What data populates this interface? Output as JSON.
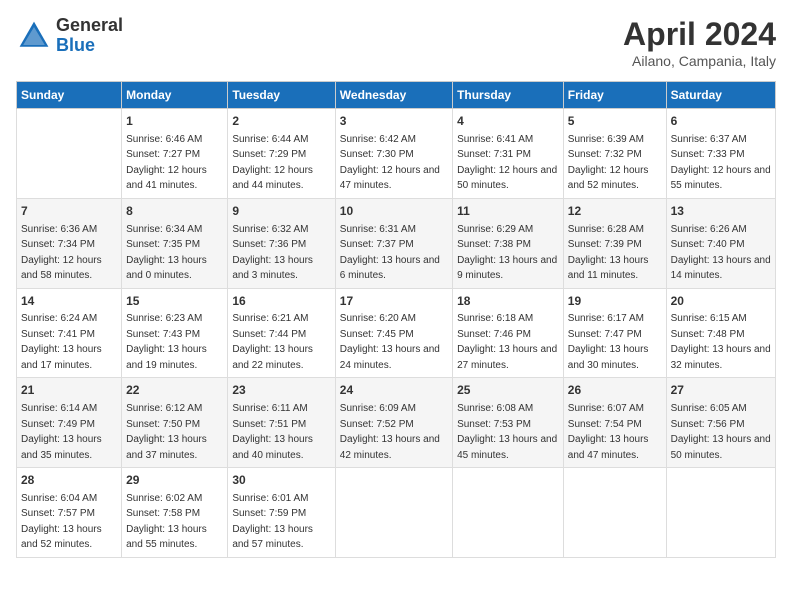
{
  "header": {
    "logo_general": "General",
    "logo_blue": "Blue",
    "title": "April 2024",
    "subtitle": "Ailano, Campania, Italy"
  },
  "weekdays": [
    "Sunday",
    "Monday",
    "Tuesday",
    "Wednesday",
    "Thursday",
    "Friday",
    "Saturday"
  ],
  "weeks": [
    [
      {
        "day": "",
        "sunrise": "",
        "sunset": "",
        "daylight": ""
      },
      {
        "day": "1",
        "sunrise": "Sunrise: 6:46 AM",
        "sunset": "Sunset: 7:27 PM",
        "daylight": "Daylight: 12 hours and 41 minutes."
      },
      {
        "day": "2",
        "sunrise": "Sunrise: 6:44 AM",
        "sunset": "Sunset: 7:29 PM",
        "daylight": "Daylight: 12 hours and 44 minutes."
      },
      {
        "day": "3",
        "sunrise": "Sunrise: 6:42 AM",
        "sunset": "Sunset: 7:30 PM",
        "daylight": "Daylight: 12 hours and 47 minutes."
      },
      {
        "day": "4",
        "sunrise": "Sunrise: 6:41 AM",
        "sunset": "Sunset: 7:31 PM",
        "daylight": "Daylight: 12 hours and 50 minutes."
      },
      {
        "day": "5",
        "sunrise": "Sunrise: 6:39 AM",
        "sunset": "Sunset: 7:32 PM",
        "daylight": "Daylight: 12 hours and 52 minutes."
      },
      {
        "day": "6",
        "sunrise": "Sunrise: 6:37 AM",
        "sunset": "Sunset: 7:33 PM",
        "daylight": "Daylight: 12 hours and 55 minutes."
      }
    ],
    [
      {
        "day": "7",
        "sunrise": "Sunrise: 6:36 AM",
        "sunset": "Sunset: 7:34 PM",
        "daylight": "Daylight: 12 hours and 58 minutes."
      },
      {
        "day": "8",
        "sunrise": "Sunrise: 6:34 AM",
        "sunset": "Sunset: 7:35 PM",
        "daylight": "Daylight: 13 hours and 0 minutes."
      },
      {
        "day": "9",
        "sunrise": "Sunrise: 6:32 AM",
        "sunset": "Sunset: 7:36 PM",
        "daylight": "Daylight: 13 hours and 3 minutes."
      },
      {
        "day": "10",
        "sunrise": "Sunrise: 6:31 AM",
        "sunset": "Sunset: 7:37 PM",
        "daylight": "Daylight: 13 hours and 6 minutes."
      },
      {
        "day": "11",
        "sunrise": "Sunrise: 6:29 AM",
        "sunset": "Sunset: 7:38 PM",
        "daylight": "Daylight: 13 hours and 9 minutes."
      },
      {
        "day": "12",
        "sunrise": "Sunrise: 6:28 AM",
        "sunset": "Sunset: 7:39 PM",
        "daylight": "Daylight: 13 hours and 11 minutes."
      },
      {
        "day": "13",
        "sunrise": "Sunrise: 6:26 AM",
        "sunset": "Sunset: 7:40 PM",
        "daylight": "Daylight: 13 hours and 14 minutes."
      }
    ],
    [
      {
        "day": "14",
        "sunrise": "Sunrise: 6:24 AM",
        "sunset": "Sunset: 7:41 PM",
        "daylight": "Daylight: 13 hours and 17 minutes."
      },
      {
        "day": "15",
        "sunrise": "Sunrise: 6:23 AM",
        "sunset": "Sunset: 7:43 PM",
        "daylight": "Daylight: 13 hours and 19 minutes."
      },
      {
        "day": "16",
        "sunrise": "Sunrise: 6:21 AM",
        "sunset": "Sunset: 7:44 PM",
        "daylight": "Daylight: 13 hours and 22 minutes."
      },
      {
        "day": "17",
        "sunrise": "Sunrise: 6:20 AM",
        "sunset": "Sunset: 7:45 PM",
        "daylight": "Daylight: 13 hours and 24 minutes."
      },
      {
        "day": "18",
        "sunrise": "Sunrise: 6:18 AM",
        "sunset": "Sunset: 7:46 PM",
        "daylight": "Daylight: 13 hours and 27 minutes."
      },
      {
        "day": "19",
        "sunrise": "Sunrise: 6:17 AM",
        "sunset": "Sunset: 7:47 PM",
        "daylight": "Daylight: 13 hours and 30 minutes."
      },
      {
        "day": "20",
        "sunrise": "Sunrise: 6:15 AM",
        "sunset": "Sunset: 7:48 PM",
        "daylight": "Daylight: 13 hours and 32 minutes."
      }
    ],
    [
      {
        "day": "21",
        "sunrise": "Sunrise: 6:14 AM",
        "sunset": "Sunset: 7:49 PM",
        "daylight": "Daylight: 13 hours and 35 minutes."
      },
      {
        "day": "22",
        "sunrise": "Sunrise: 6:12 AM",
        "sunset": "Sunset: 7:50 PM",
        "daylight": "Daylight: 13 hours and 37 minutes."
      },
      {
        "day": "23",
        "sunrise": "Sunrise: 6:11 AM",
        "sunset": "Sunset: 7:51 PM",
        "daylight": "Daylight: 13 hours and 40 minutes."
      },
      {
        "day": "24",
        "sunrise": "Sunrise: 6:09 AM",
        "sunset": "Sunset: 7:52 PM",
        "daylight": "Daylight: 13 hours and 42 minutes."
      },
      {
        "day": "25",
        "sunrise": "Sunrise: 6:08 AM",
        "sunset": "Sunset: 7:53 PM",
        "daylight": "Daylight: 13 hours and 45 minutes."
      },
      {
        "day": "26",
        "sunrise": "Sunrise: 6:07 AM",
        "sunset": "Sunset: 7:54 PM",
        "daylight": "Daylight: 13 hours and 47 minutes."
      },
      {
        "day": "27",
        "sunrise": "Sunrise: 6:05 AM",
        "sunset": "Sunset: 7:56 PM",
        "daylight": "Daylight: 13 hours and 50 minutes."
      }
    ],
    [
      {
        "day": "28",
        "sunrise": "Sunrise: 6:04 AM",
        "sunset": "Sunset: 7:57 PM",
        "daylight": "Daylight: 13 hours and 52 minutes."
      },
      {
        "day": "29",
        "sunrise": "Sunrise: 6:02 AM",
        "sunset": "Sunset: 7:58 PM",
        "daylight": "Daylight: 13 hours and 55 minutes."
      },
      {
        "day": "30",
        "sunrise": "Sunrise: 6:01 AM",
        "sunset": "Sunset: 7:59 PM",
        "daylight": "Daylight: 13 hours and 57 minutes."
      },
      {
        "day": "",
        "sunrise": "",
        "sunset": "",
        "daylight": ""
      },
      {
        "day": "",
        "sunrise": "",
        "sunset": "",
        "daylight": ""
      },
      {
        "day": "",
        "sunrise": "",
        "sunset": "",
        "daylight": ""
      },
      {
        "day": "",
        "sunrise": "",
        "sunset": "",
        "daylight": ""
      }
    ]
  ]
}
